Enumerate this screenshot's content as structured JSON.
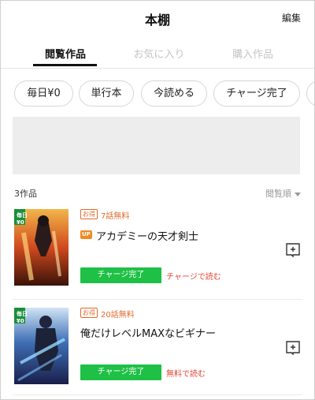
{
  "header": {
    "title": "本棚",
    "edit_label": "編集"
  },
  "tabs": [
    {
      "label": "閲覧作品",
      "active": true
    },
    {
      "label": "お気に入り",
      "active": false
    },
    {
      "label": "購入作品",
      "active": false
    }
  ],
  "filters": [
    {
      "label": "毎日¥0"
    },
    {
      "label": "単行本"
    },
    {
      "label": "今読める"
    },
    {
      "label": "チャージ完了"
    }
  ],
  "list": {
    "count_label": "3作品",
    "sort_label": "閲覧順"
  },
  "items": [
    {
      "cover_tag": "毎日\n¥0",
      "otoku_badge": "お得",
      "free_label": "7話無料",
      "up_badge": "UP",
      "title": "アカデミーの天才剣士",
      "button_label": "チャージ完了",
      "action_label": "チャージで読む"
    },
    {
      "cover_tag": "毎日\n¥0",
      "otoku_badge": "お得",
      "free_label": "20話無料",
      "title": "俺だけレベルMAXなビギナー",
      "button_label": "チャージ完了",
      "action_label": "無料で読む"
    }
  ],
  "colors": {
    "accent_green": "#1fc046",
    "free_orange": "#e36a2e",
    "read_red": "#e0483a"
  },
  "icons": {
    "sort": "triangle-down-icon",
    "shelf_item": "bookmark-plus-icon"
  }
}
